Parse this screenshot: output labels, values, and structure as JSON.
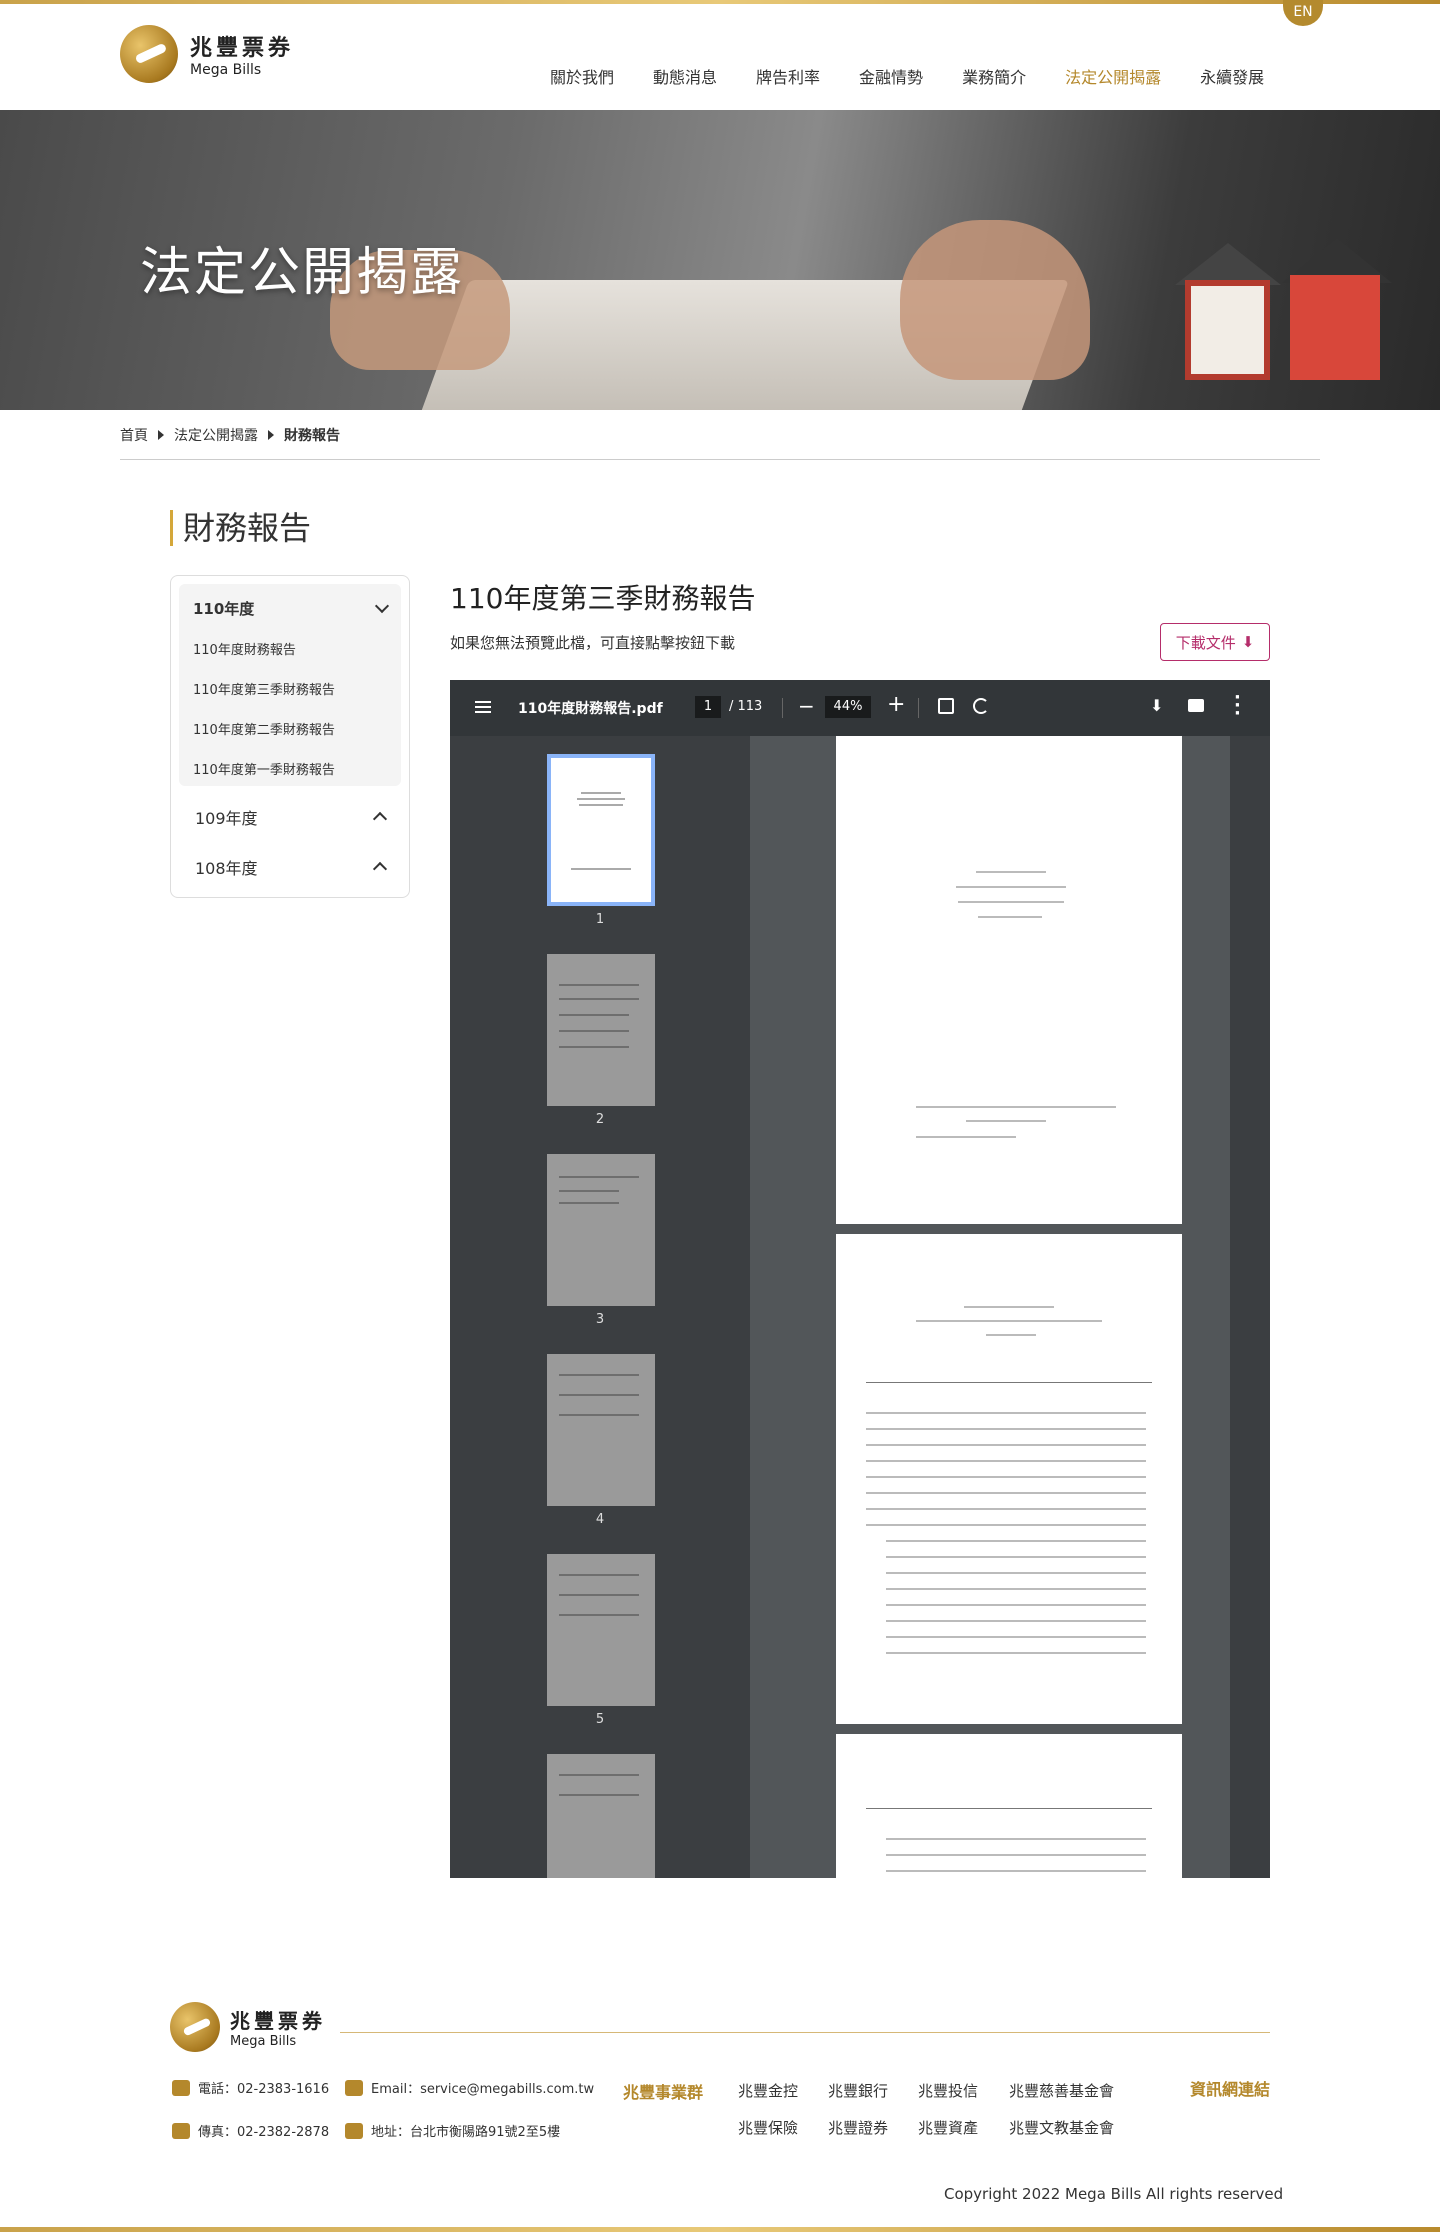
{
  "brand": {
    "name_zh": "兆豐票券",
    "name_en": "Mega Bills"
  },
  "lang_switch": "EN",
  "nav": [
    "關於我們",
    "動態消息",
    "牌告利率",
    "金融情勢",
    "業務簡介",
    "法定公開揭露",
    "永續發展"
  ],
  "hero": {
    "title": "法定公開揭露"
  },
  "breadcrumb": {
    "home": "首頁",
    "parent": "法定公開揭露",
    "current": "財務報告"
  },
  "section_title": "財務報告",
  "sidebar": {
    "open_group": "110年度",
    "items": [
      "110年度財務報告",
      "110年度第三季財務報告",
      "110年度第二季財務報告",
      "110年度第一季財務報告"
    ],
    "group2": "109年度",
    "group3": "108年度"
  },
  "document": {
    "title": "110年度第三季財務報告",
    "note": "如果您無法預覽此檔，可直接點擊按鈕下載",
    "download_label": "下載文件"
  },
  "viewer": {
    "filename": "110年度財務報告.pdf",
    "page": "1",
    "page_total": "/ 113",
    "zoom": "44%",
    "thumb_numbers": [
      "1",
      "2",
      "3",
      "4",
      "5"
    ]
  },
  "footer": {
    "phone": "電話：02-2383-1616",
    "email": "Email：service@megabills.com.tw",
    "fax": "傳真：02-2382-2878",
    "address": "地址：台北市衡陽路91號2至5樓",
    "group_title": "兆豐事業群",
    "links_row1": [
      "兆豐金控",
      "兆豐銀行",
      "兆豐投信",
      "兆豐慈善基金會"
    ],
    "links_row2": [
      "兆豐保險",
      "兆豐證券",
      "兆豐資產",
      "兆豐文教基金會"
    ],
    "info_links": "資訊網連結",
    "copyright": "Copyright 2022 Mega Bills All rights reserved"
  }
}
